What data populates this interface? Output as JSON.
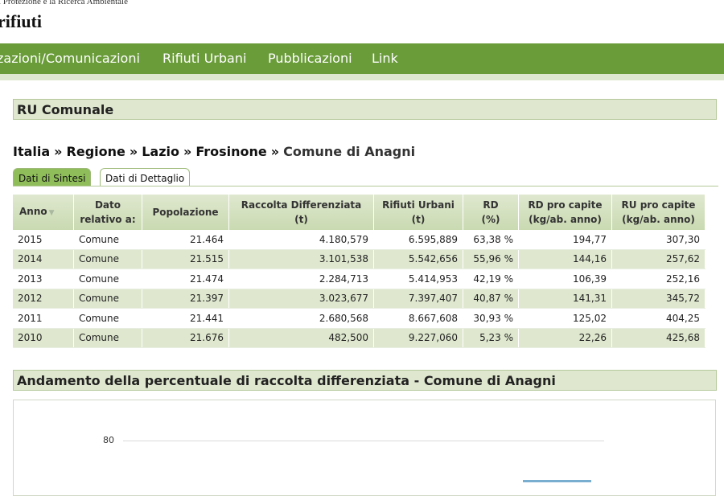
{
  "header": {
    "org": "i Protezione e la Ricerca Ambientale",
    "site_title": "rifiuti"
  },
  "nav": {
    "items": [
      {
        "label": "zazioni/Comunicazioni"
      },
      {
        "label": "Rifiuti Urbani"
      },
      {
        "label": "Pubblicazioni"
      },
      {
        "label": "Link"
      }
    ]
  },
  "section": {
    "title": "RU Comunale"
  },
  "breadcrumb": {
    "items": [
      "Italia",
      "Regione",
      "Lazio",
      "Frosinone",
      "Comune di Anagni"
    ],
    "separator": "»"
  },
  "tabs": {
    "active": "Dati di Sintesi",
    "inactive": "Dati di Dettaglio"
  },
  "table": {
    "headers": {
      "anno": "Anno",
      "dato_1": "Dato",
      "dato_2": "relativo a:",
      "popolazione": "Popolazione",
      "rd_tot_1": "Raccolta Differenziata",
      "rd_tot_2": "(t)",
      "ru_1": "Rifiuti Urbani",
      "ru_2": "(t)",
      "rd_1": "RD",
      "rd_2": "(%)",
      "rd_pc_1": "RD pro capite",
      "rd_pc_2": "(kg/ab. anno)",
      "ru_pc_1": "RU pro capite",
      "ru_pc_2": "(kg/ab. anno)"
    },
    "rows": [
      {
        "anno": "2015",
        "dato": "Comune",
        "popolazione": "21.464",
        "rd_t": "4.180,579",
        "ru_t": "6.595,889",
        "rd_pct": "63,38 %",
        "rd_pc": "194,77",
        "ru_pc": "307,30"
      },
      {
        "anno": "2014",
        "dato": "Comune",
        "popolazione": "21.515",
        "rd_t": "3.101,538",
        "ru_t": "5.542,656",
        "rd_pct": "55,96 %",
        "rd_pc": "144,16",
        "ru_pc": "257,62"
      },
      {
        "anno": "2013",
        "dato": "Comune",
        "popolazione": "21.474",
        "rd_t": "2.284,713",
        "ru_t": "5.414,953",
        "rd_pct": "42,19 %",
        "rd_pc": "106,39",
        "ru_pc": "252,16"
      },
      {
        "anno": "2012",
        "dato": "Comune",
        "popolazione": "21.397",
        "rd_t": "3.023,677",
        "ru_t": "7.397,407",
        "rd_pct": "40,87 %",
        "rd_pc": "141,31",
        "ru_pc": "345,72"
      },
      {
        "anno": "2011",
        "dato": "Comune",
        "popolazione": "21.441",
        "rd_t": "2.680,568",
        "ru_t": "8.667,608",
        "rd_pct": "30,93 %",
        "rd_pc": "125,02",
        "ru_pc": "404,25"
      },
      {
        "anno": "2010",
        "dato": "Comune",
        "popolazione": "21.676",
        "rd_t": "482,500",
        "ru_t": "9.227,060",
        "rd_pct": "5,23 %",
        "rd_pc": "22,26",
        "ru_pc": "425,68"
      }
    ]
  },
  "chart_section": {
    "title": "Andamento della percentuale di raccolta differenziata - Comune di Anagni",
    "ytick_visible": "80"
  },
  "colors": {
    "nav_green": "#6a9c3a",
    "section_bg": "#dfe8cf",
    "tab_active": "#8fbd5a"
  },
  "icons": {
    "sort": "sort-down-icon"
  }
}
